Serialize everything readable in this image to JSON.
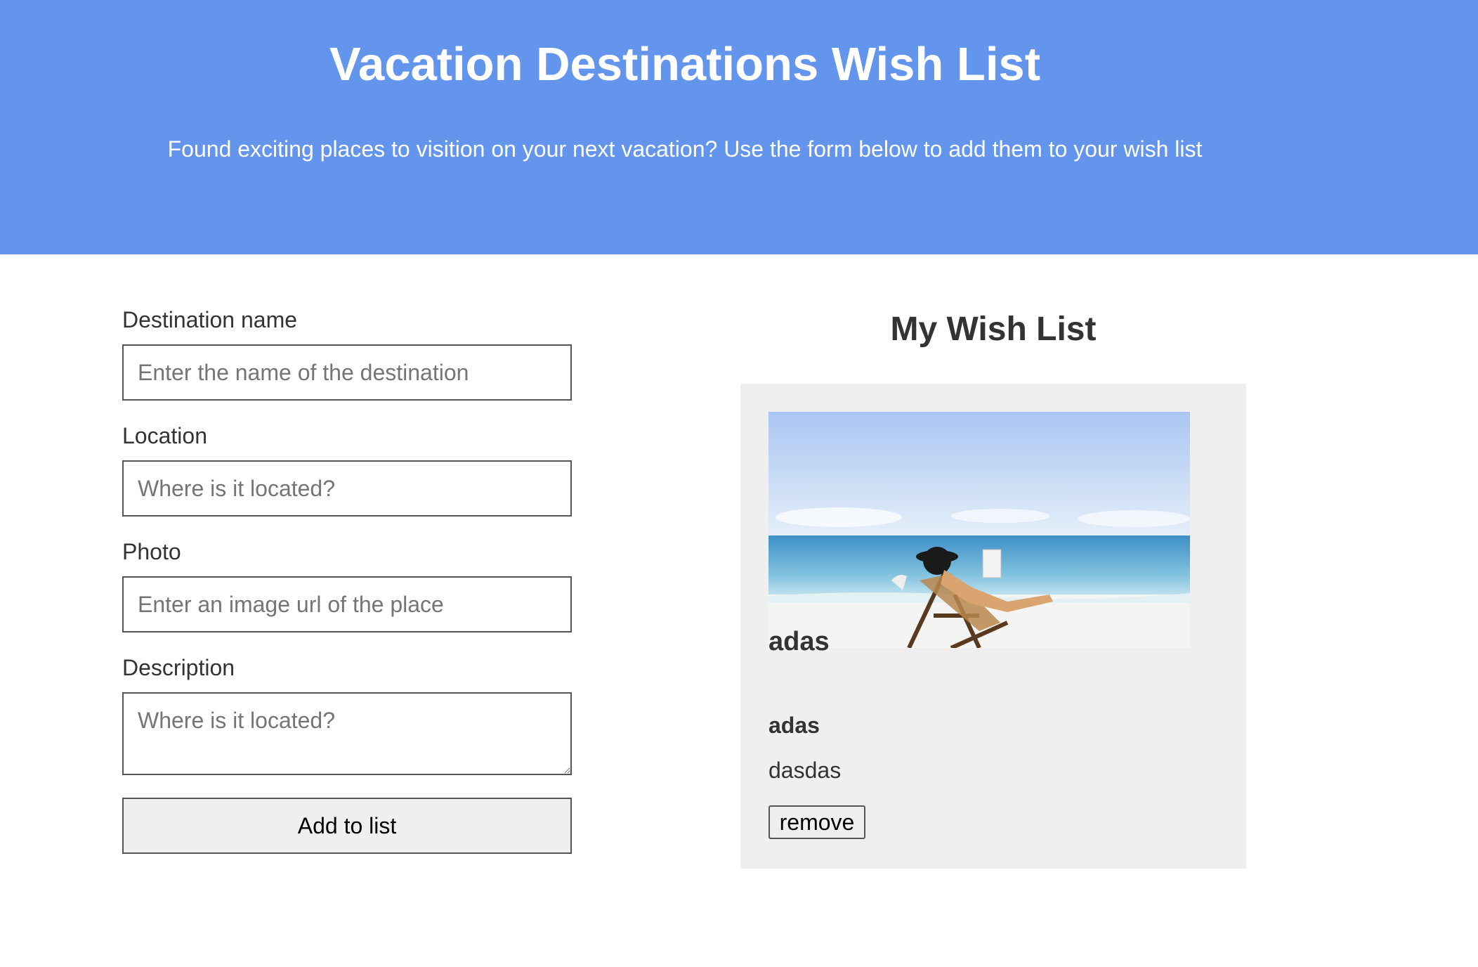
{
  "header": {
    "title": "Vacation Destinations Wish List",
    "subtitle": "Found exciting places to visition on your next vacation? Use the form below to add them to your wish list"
  },
  "form": {
    "name_label": "Destination name",
    "name_placeholder": "Enter the name of the destination",
    "location_label": "Location",
    "location_placeholder": "Where is it located?",
    "photo_label": "Photo",
    "photo_placeholder": "Enter an image url of the place",
    "description_label": "Description",
    "description_placeholder": "Where is it located?",
    "submit_label": "Add to list"
  },
  "wishlist": {
    "title": "My Wish List",
    "items": [
      {
        "name": "adas",
        "location": "adas",
        "description": "dasdas",
        "photo_icon": "beach-photo",
        "remove_label": "remove"
      }
    ]
  },
  "colors": {
    "header_bg": "#6495ED",
    "card_bg": "#efefef"
  }
}
